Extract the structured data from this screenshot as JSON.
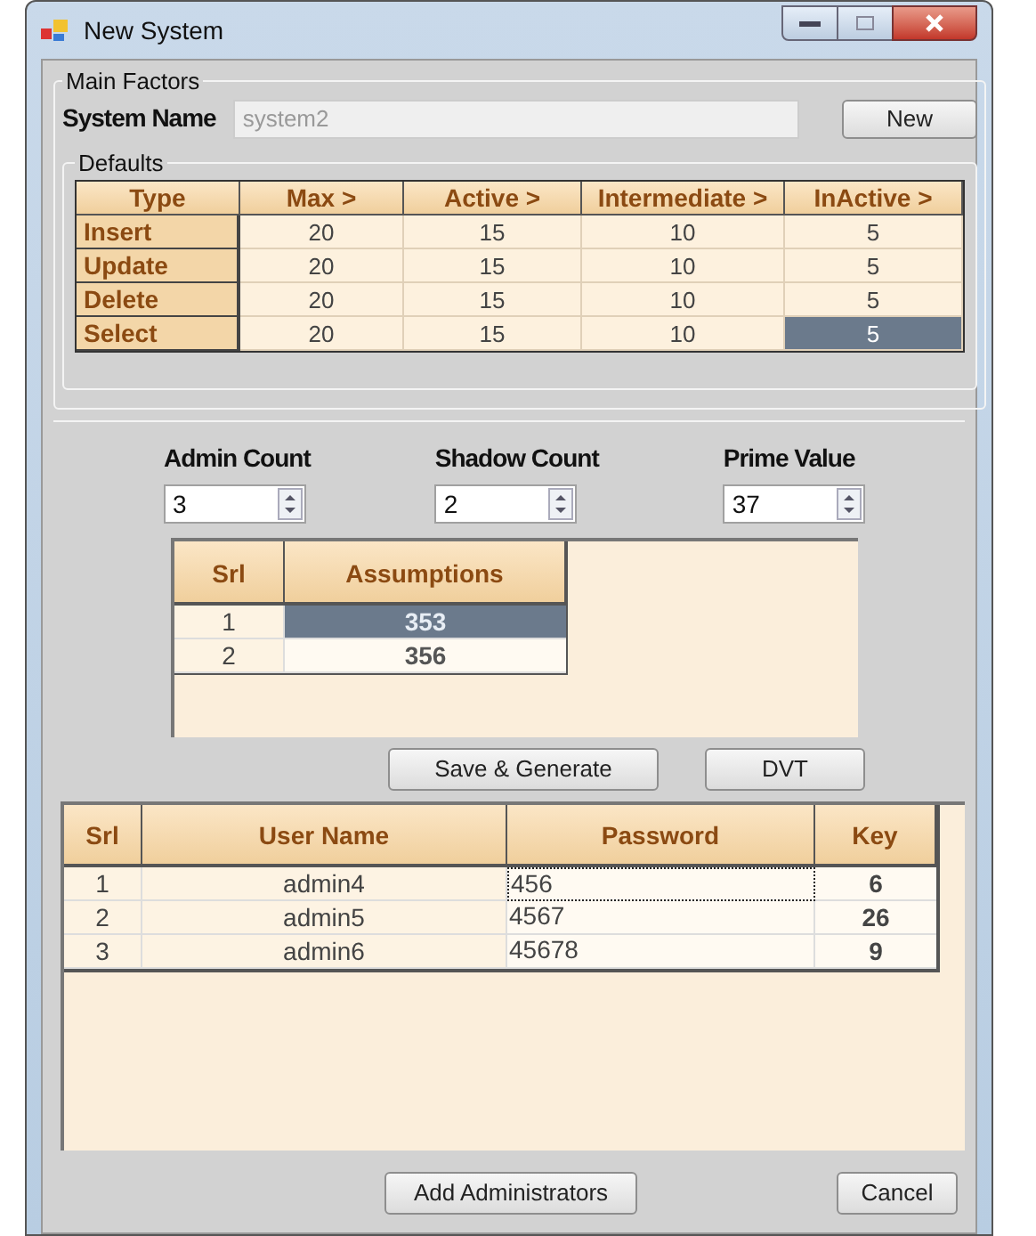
{
  "window": {
    "title": "New System"
  },
  "main_factors": {
    "legend": "Main Factors",
    "system_name_label": "System Name",
    "system_name": {
      "value": "system2",
      "disabled": true
    },
    "new_button": "New"
  },
  "defaults": {
    "legend": "Defaults",
    "columns": [
      "Type",
      "Max >",
      "Active >",
      "Intermediate >",
      "InActive >"
    ],
    "rows": [
      {
        "cells": [
          {
            "text": "Insert",
            "selected": false
          },
          {
            "text": "20",
            "selected": false
          },
          {
            "text": "15",
            "selected": false
          },
          {
            "text": "10",
            "selected": false
          },
          {
            "text": "5",
            "selected": false
          }
        ]
      },
      {
        "cells": [
          {
            "text": "Update",
            "selected": false
          },
          {
            "text": "20",
            "selected": false
          },
          {
            "text": "15",
            "selected": false
          },
          {
            "text": "10",
            "selected": false
          },
          {
            "text": "5",
            "selected": false
          }
        ]
      },
      {
        "cells": [
          {
            "text": "Delete",
            "selected": false
          },
          {
            "text": "20",
            "selected": false
          },
          {
            "text": "15",
            "selected": false
          },
          {
            "text": "10",
            "selected": false
          },
          {
            "text": "5",
            "selected": false
          }
        ]
      },
      {
        "cells": [
          {
            "text": "Select",
            "selected": false
          },
          {
            "text": "20",
            "selected": false
          },
          {
            "text": "15",
            "selected": false
          },
          {
            "text": "10",
            "selected": false
          },
          {
            "text": "5",
            "selected": true
          }
        ]
      }
    ]
  },
  "spinners": [
    {
      "label": "Admin Count",
      "value": "3"
    },
    {
      "label": "Shadow Count",
      "value": "2"
    },
    {
      "label": "Prime Value",
      "value": "37"
    }
  ],
  "assumptions": {
    "columns": [
      "Srl",
      "Assumptions"
    ],
    "rows": [
      {
        "srl": "1",
        "value": "353",
        "selected": true
      },
      {
        "srl": "2",
        "value": "356",
        "selected": false
      }
    ]
  },
  "actions": [
    "Save & Generate",
    "DVT"
  ],
  "users": {
    "columns": [
      "Srl",
      "User Name",
      "Password",
      "Key"
    ],
    "rows": [
      {
        "srl": "1",
        "user": "admin4",
        "password": "456",
        "key": "6",
        "focused": true
      },
      {
        "srl": "2",
        "user": "admin5",
        "password": "4567",
        "key": "26",
        "focused": false
      },
      {
        "srl": "3",
        "user": "admin6",
        "password": "45678",
        "key": "9",
        "focused": false
      }
    ]
  },
  "buttons": [
    "Add Administrators",
    "Cancel"
  ]
}
